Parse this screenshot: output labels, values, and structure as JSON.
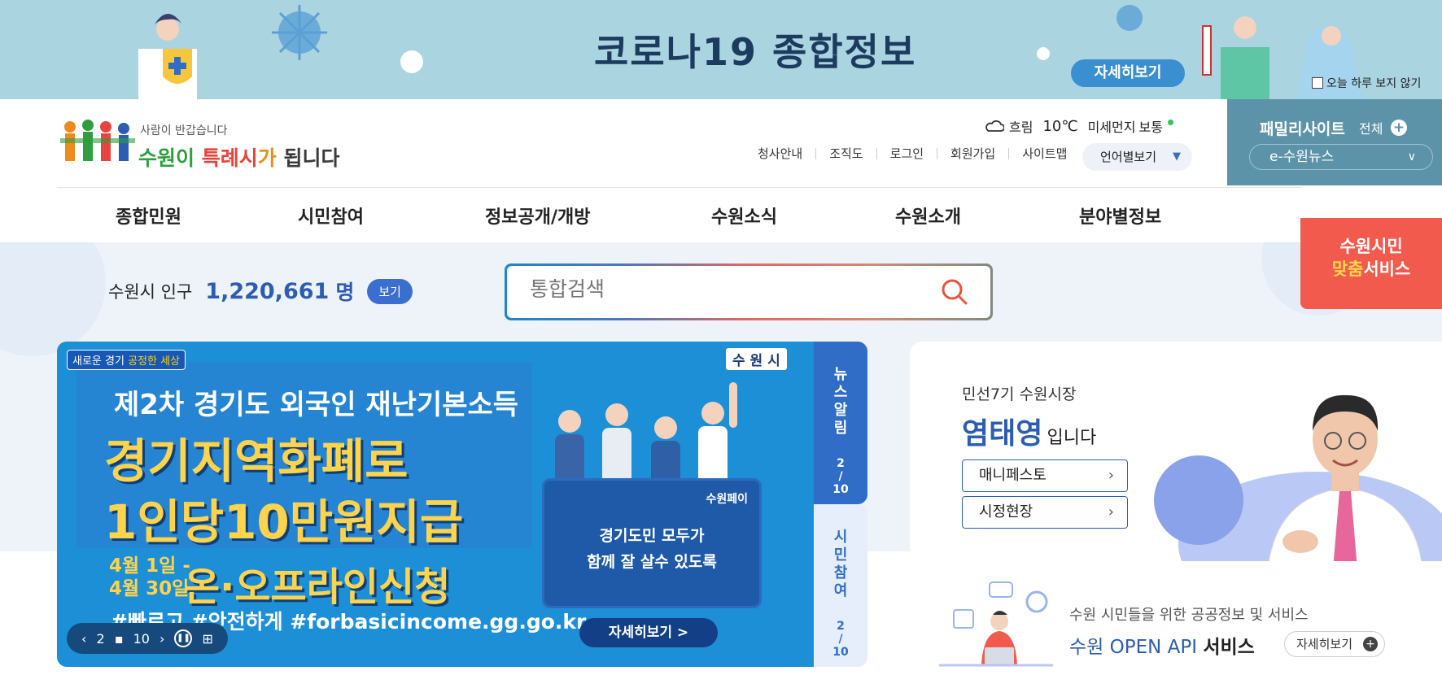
{
  "top_banner": {
    "title": "코로나19 종합정보",
    "detail_button": "자세히보기",
    "no_show_today": "오늘 하루 보지 않기"
  },
  "header": {
    "logo": {
      "tagline": "사람이 반갑습니다",
      "main_part1": "수원이 ",
      "main_part2": "특례시",
      "main_part3": "가",
      "main_part4": " 됩니다"
    },
    "weather": {
      "condition": "흐림",
      "temperature": "10℃",
      "fine_dust_label": "미세먼지",
      "fine_dust_value": "보통"
    },
    "util_nav": [
      "청사안내",
      "조직도",
      "로그인",
      "회원가입",
      "사이트맵"
    ],
    "language": "언어별보기",
    "family_site": {
      "label": "패밀리사이트",
      "all": "전체",
      "selected": "e-수원뉴스"
    }
  },
  "gnb": [
    "종합민원",
    "시민참여",
    "정보공개/개방",
    "수원소식",
    "수원소개",
    "분야별정보"
  ],
  "citizen_service": {
    "line1": "수원시민",
    "line2_highlight": "맞춤",
    "line2_rest": "서비스"
  },
  "population": {
    "label": "수원시 인구",
    "value": "1,220,661",
    "unit": "명",
    "view_button": "보기"
  },
  "search": {
    "placeholder": "통합검색"
  },
  "main_banner": {
    "tag_part1": "새로운 경기",
    "tag_part2": "공정한 세상",
    "brand": "수 원 시",
    "subtitle": "제2차 경기도 외국인 재난기본소득",
    "headline1": "경기지역화폐로",
    "headline2": "1인당10만원지급",
    "date_line1": "4월 1일 -",
    "date_line2": "4월 30일",
    "apply_text": "온·오프라인신청",
    "hashtags": "#빠르고 #안전하게 #forbasicincome.gg.go.kr",
    "card_brand": "수원페이",
    "card_text_line1": "경기도민 모두가",
    "card_text_line2": "함께 잘 살수 있도록",
    "more_button": "자세히보기 >",
    "controls": {
      "current": "2",
      "total": "10"
    }
  },
  "side_tabs": [
    {
      "label_chars": [
        "뉴",
        "스",
        "알",
        "림"
      ],
      "current": "2",
      "total": "10"
    },
    {
      "label_chars": [
        "시",
        "민",
        "참",
        "여"
      ],
      "current": "2",
      "total": "10"
    }
  ],
  "mayor": {
    "subtitle": "민선7기 수원시장",
    "name": "염태영",
    "suffix": "입니다",
    "buttons": [
      "매니페스토",
      "시정현장"
    ]
  },
  "open_api": {
    "subtitle": "수원 시민들을 위한 공공정보 및 서비스",
    "title_blue": "수원 OPEN API",
    "title_dark": "서비스",
    "more": "자세히보기"
  },
  "colors": {
    "banner_bg": "#a9d4e0",
    "primary_blue": "#2c5db2",
    "family_site_bg": "#5c93a8",
    "citizen_service_bg": "#f25a4e",
    "main_banner_bg": "#1c8fd7"
  }
}
